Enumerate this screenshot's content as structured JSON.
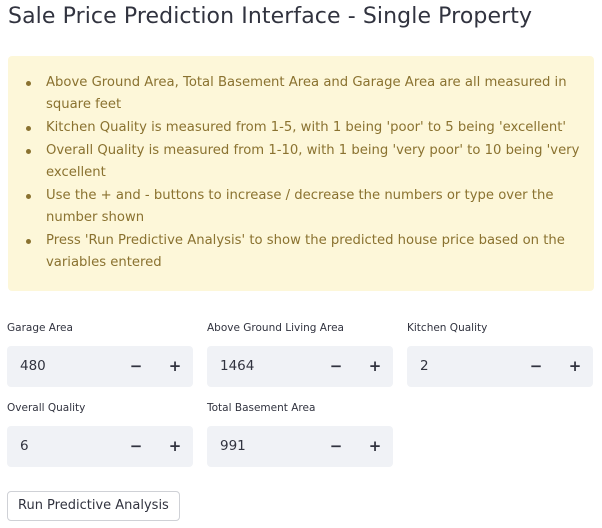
{
  "page": {
    "title": "Sale Price Prediction Interface - Single Property"
  },
  "info": {
    "items": [
      "Above Ground Area, Total Basement Area and Garage Area are all measured in square feet",
      "Kitchen Quality is measured from 1-5, with 1 being 'poor' to 5 being 'excellent'",
      "Overall Quality is measured from 1-10, with 1 being 'very poor' to 10 being 'very excellent",
      "Use the + and - buttons to increase / decrease the numbers or type over the number shown",
      "Press 'Run Predictive Analysis' to show the predicted house price based on the variables entered"
    ]
  },
  "fields": {
    "garage_area": {
      "label": "Garage Area",
      "value": "480"
    },
    "above_ground_living_area": {
      "label": "Above Ground Living Area",
      "value": "1464"
    },
    "kitchen_quality": {
      "label": "Kitchen Quality",
      "value": "2"
    },
    "overall_quality": {
      "label": "Overall Quality",
      "value": "6"
    },
    "total_basement_area": {
      "label": "Total Basement Area",
      "value": "991"
    }
  },
  "stepper": {
    "minus_label": "−",
    "plus_label": "+"
  },
  "actions": {
    "run_label": "Run Predictive Analysis"
  },
  "colors": {
    "info_background": "#fdf7d9",
    "info_text": "#8a7230",
    "input_background": "#f0f2f6",
    "text": "#31333f"
  }
}
